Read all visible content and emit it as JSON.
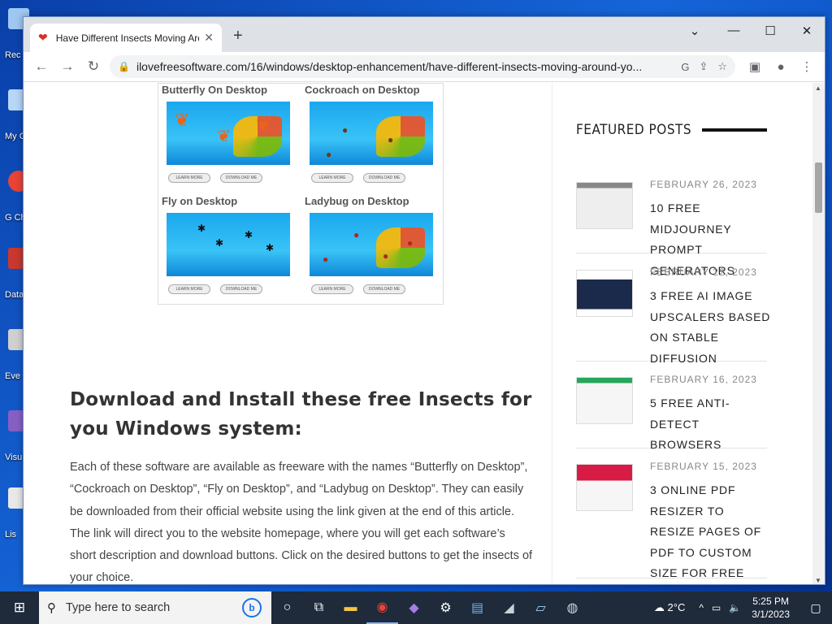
{
  "desktop": {
    "icons": [
      {
        "label": "Rec",
        "icon": "recycle-bin-icon",
        "color": "#9ec8f2"
      },
      {
        "label": "My C",
        "icon": "computer-icon",
        "color": "#b7d7f7"
      },
      {
        "label": "G Ch",
        "icon": "chrome-icon",
        "color": "#e84335"
      },
      {
        "label": "Data",
        "icon": "database-icon",
        "color": "#c8382e"
      },
      {
        "label": "Eve",
        "icon": "event-icon",
        "color": "#d0d0d0"
      },
      {
        "label": "Visu",
        "icon": "visual-studio-icon",
        "color": "#865fc5"
      },
      {
        "label": "Lis",
        "icon": "list-icon",
        "color": "#e8e8e8"
      }
    ]
  },
  "browser": {
    "tab": {
      "title": "Have Different Insects Moving Around Your Windows Desktop",
      "favicon": "heart-icon"
    },
    "url": "ilovefreesoftware.com/16/windows/desktop-enhancement/have-different-insects-moving-around-yo...",
    "window_controls": {
      "dropdown": "⌄",
      "minimize": "—",
      "maximize": "☐",
      "close": "✕"
    }
  },
  "article": {
    "grid_labels": [
      "Butterfly On Desktop",
      "Cockroach on Desktop",
      "Fly on Desktop",
      "Ladybug on Desktop"
    ],
    "grid_button_text": [
      "LEARN MORE",
      "DOWNLOAD ME"
    ],
    "heading": "Download and Install these free Insects for you Windows system:",
    "paragraph": "Each of these software are available as freeware with the names “Butterfly on Desktop”, “Cockroach on Desktop”, “Fly on Desktop”, and “Ladybug on Desktop”. They can easily be downloaded from their official website using the link given at the end of this article. The link will direct you to the website homepage, where you will get each software’s short description and download buttons. Click on the desired buttons to get the insects of your choice."
  },
  "sidebar": {
    "featured_title": "FEATURED POSTS",
    "posts": [
      {
        "date": "FEBRUARY 26, 2023",
        "title": "10 Free Midjourney Prompt Generators"
      },
      {
        "date": "FEBRUARY 22, 2023",
        "title": "3 Free AI Image Upscalers Based on Stable Diffusion"
      },
      {
        "date": "FEBRUARY 16, 2023",
        "title": "5 Free Anti-Detect Browsers"
      },
      {
        "date": "FEBRUARY 15, 2023",
        "title": "3 Online PDF Resizer to Resize Pages of PDF to Custom Size for Free"
      }
    ]
  },
  "taskbar": {
    "search_placeholder": "Type here to search",
    "weather": "2°C",
    "time": "5:25 PM",
    "date": "3/1/2023"
  }
}
